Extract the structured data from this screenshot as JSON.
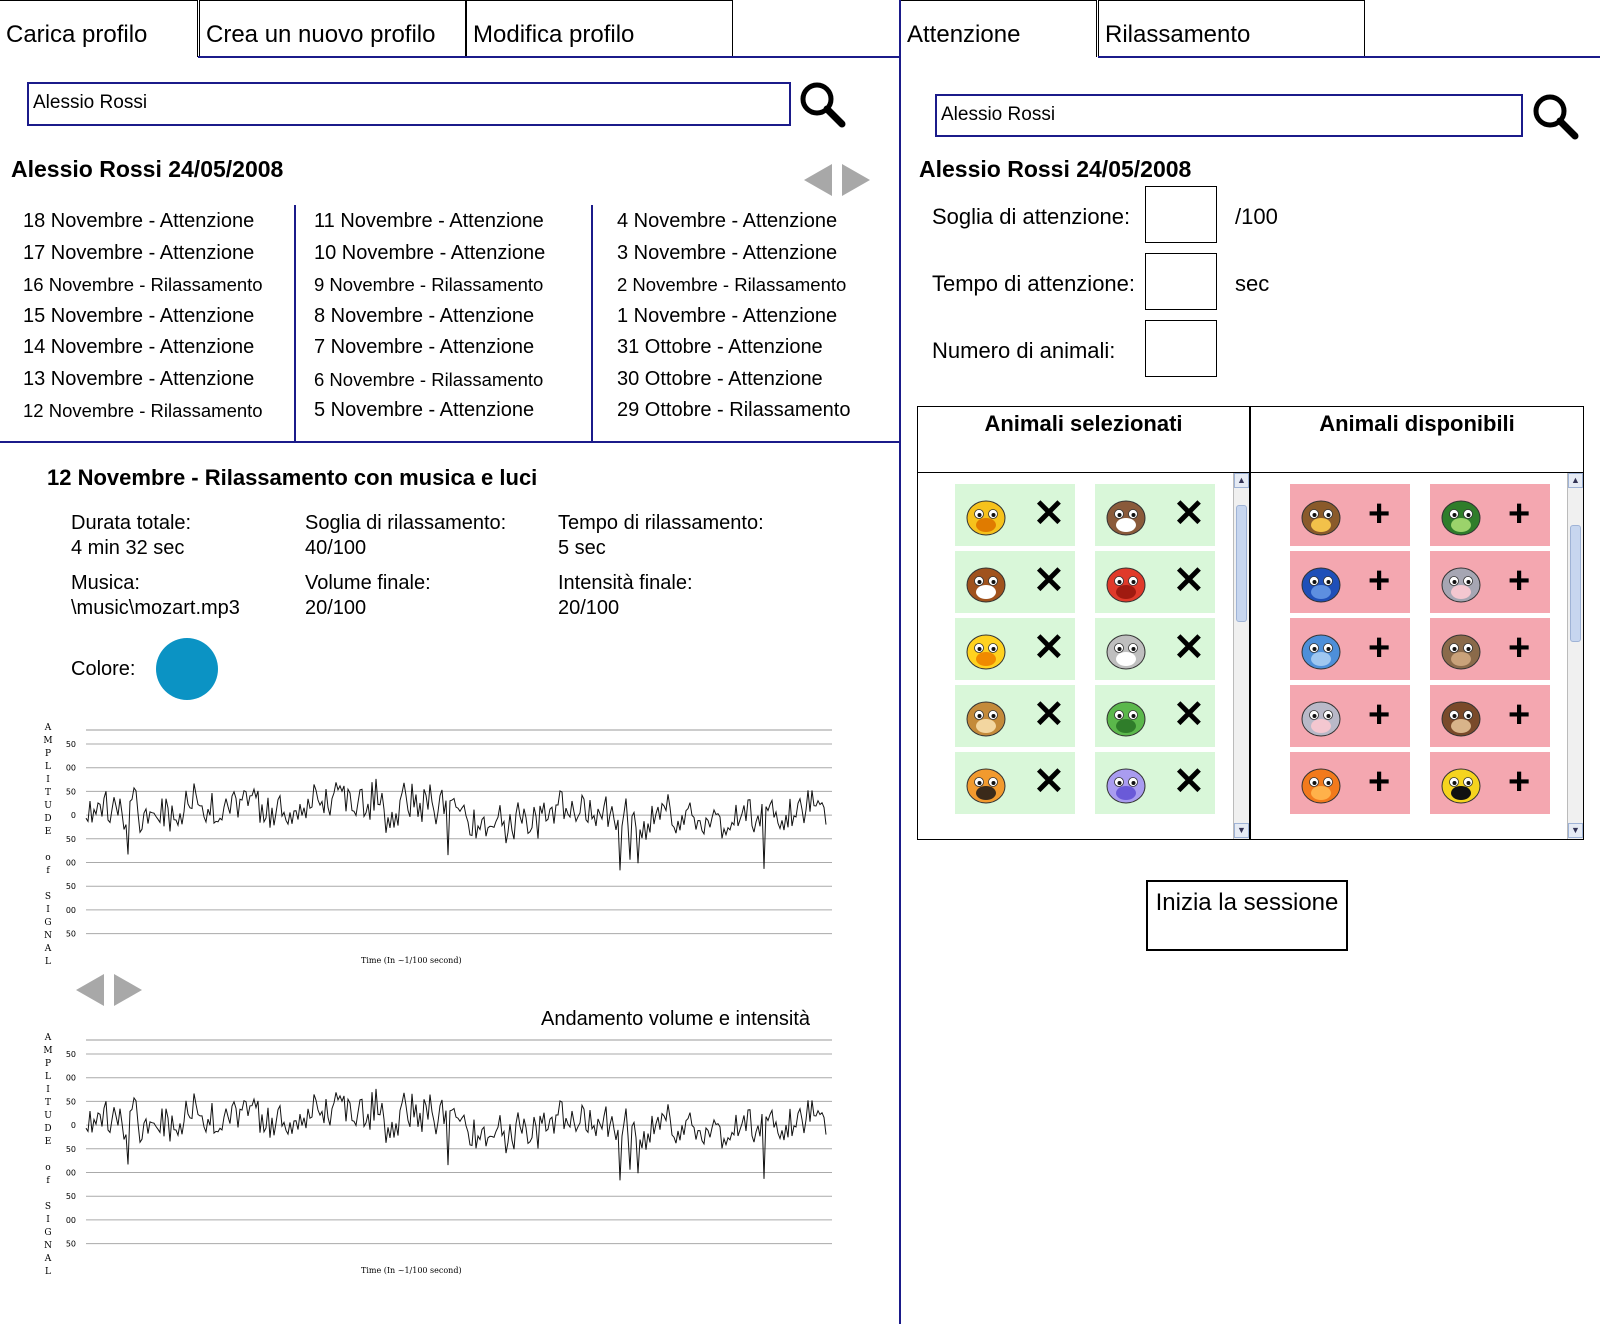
{
  "left": {
    "tabs": [
      "Carica profilo",
      "Crea un nuovo profilo",
      "Modifica profilo"
    ],
    "search_value": "Alessio Rossi",
    "profile_title": "Alessio Rossi 24/05/2008",
    "sessions": {
      "col1": [
        "18 Novembre - Attenzione",
        "17 Novembre - Attenzione",
        "16 Novembre - Rilassamento",
        "15 Novembre - Attenzione",
        "14 Novembre - Attenzione",
        "13 Novembre - Attenzione",
        "12 Novembre - Rilassamento"
      ],
      "col2": [
        "11 Novembre - Attenzione",
        "10 Novembre - Attenzione",
        "9 Novembre - Rilassamento",
        "8 Novembre - Attenzione",
        "7 Novembre - Attenzione",
        "6 Novembre - Rilassamento",
        "5 Novembre - Attenzione"
      ],
      "col3": [
        "4 Novembre - Attenzione",
        "3 Novembre - Attenzione",
        "2 Novembre - Rilassamento",
        "1 Novembre - Attenzione",
        "31 Ottobre - Attenzione",
        "30 Ottobre - Attenzione",
        "29 Ottobre - Rilassamento"
      ]
    },
    "detail": {
      "title": "12 Novembre - Rilassamento con musica e luci",
      "durata_label": "Durata totale:",
      "durata_value": "4 min 32 sec",
      "soglia_label": "Soglia di rilassamento:",
      "soglia_value": "40/100",
      "tempo_label": "Tempo di rilassamento:",
      "tempo_value": "5 sec",
      "musica_label": "Musica:",
      "musica_value": "\\music\\mozart.mp3",
      "volume_label": "Volume finale:",
      "volume_value": "20/100",
      "intensita_label": "Intensità finale:",
      "intensita_value": "20/100",
      "colore_label": "Colore:",
      "colore_value": "#0b93c4"
    },
    "chart1": {
      "ylabel": "AMPLITUDE of SIGNAL",
      "yticks": [
        "50",
        "00",
        "50",
        "0",
        "50",
        "00",
        "50",
        "00",
        "50"
      ],
      "xlabel": "Time (In ~1/100 second)"
    },
    "chart2": {
      "title": "Andamento volume e intensità",
      "ylabel": "AMPLITUDE of SIGNAL",
      "yticks": [
        "50",
        "00",
        "50",
        "0",
        "50",
        "00",
        "50",
        "00",
        "50"
      ],
      "xlabel": "Time (In ~1/100 second)"
    }
  },
  "right": {
    "tabs": [
      "Attenzione",
      "Rilassamento"
    ],
    "search_value": "Alessio Rossi",
    "profile_title": "Alessio Rossi 24/05/2008",
    "fields": [
      {
        "label": "Soglia di attenzione:",
        "unit": "/100"
      },
      {
        "label": "Tempo di attenzione:",
        "unit": "sec"
      },
      {
        "label": "Numero di animali:",
        "unit": ""
      }
    ],
    "selected_header": "Animali selezionati",
    "available_header": "Animali disponibili",
    "selected_animals": [
      "cat",
      "cow",
      "dog",
      "crab",
      "chick",
      "sheep",
      "monkey",
      "frog",
      "tiger",
      "butterfly"
    ],
    "available_animals": [
      "lion",
      "turtle",
      "dolphin",
      "mouse",
      "whale",
      "hippo",
      "rabbit",
      "owl",
      "fish",
      "bee"
    ],
    "remove_symbol": "✕",
    "add_symbol": "+",
    "start_button": "Inizia la sessione"
  },
  "chart_data": [
    {
      "type": "line",
      "title": "",
      "xlabel": "Time (In ~1/100 second)",
      "ylabel": "AMPLITUDE of SIGNAL",
      "ytick_labels": [
        "50",
        "00",
        "50",
        "0",
        "50",
        "00",
        "50",
        "00",
        "50"
      ],
      "grid": true,
      "note": "noisy oscillating signal centered on the 0 gridline"
    },
    {
      "type": "line",
      "title": "Andamento volume e intensità",
      "xlabel": "Time (In ~1/100 second)",
      "ylabel": "AMPLITUDE of SIGNAL",
      "ytick_labels": [
        "50",
        "00",
        "50",
        "0",
        "50",
        "00",
        "50",
        "00",
        "50"
      ],
      "grid": true,
      "note": "noisy oscillating signal centered on the 0 gridline"
    }
  ]
}
